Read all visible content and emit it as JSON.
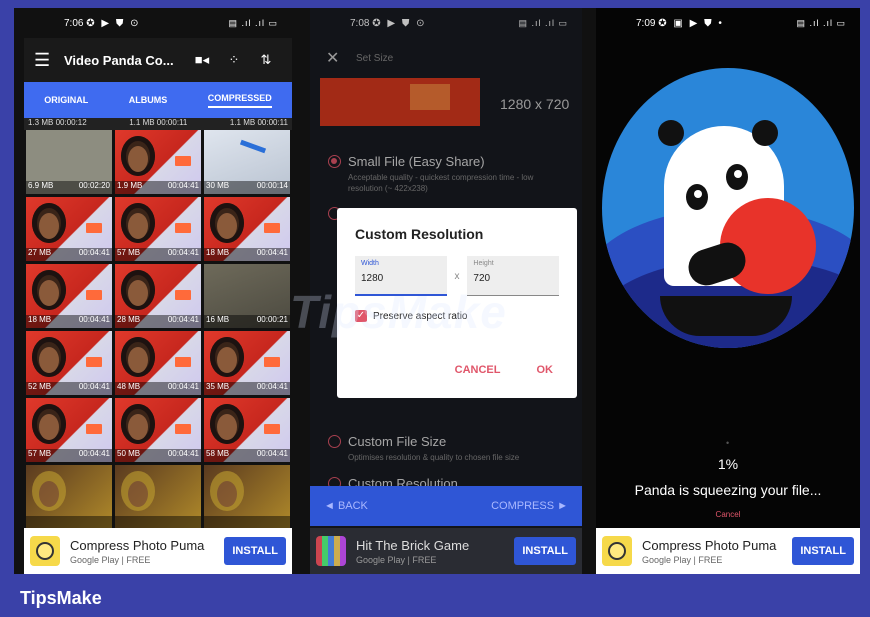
{
  "screen1": {
    "status_time": "7:06",
    "title": "Video Panda Co...",
    "tabs": [
      "ORIGINAL",
      "ALBUMS",
      "COMPRESSED"
    ],
    "active_tab": "COMPRESSED",
    "top_sizes": [
      "1.3 MB  00:00:12",
      "1.1 MB  00:00:11",
      "1.1 MB  00:00:11"
    ],
    "thumbs": [
      {
        "size": "6.9 MB",
        "dur": "00:02:20",
        "kind": "plain"
      },
      {
        "size": "1.9 MB",
        "dur": "00:04:41",
        "kind": "face"
      },
      {
        "size": "30 MB",
        "dur": "00:00:14",
        "kind": "paper"
      },
      {
        "size": "27 MB",
        "dur": "00:04:41",
        "kind": "face"
      },
      {
        "size": "57 MB",
        "dur": "00:04:41",
        "kind": "face"
      },
      {
        "size": "18 MB",
        "dur": "00:04:41",
        "kind": "face"
      },
      {
        "size": "18 MB",
        "dur": "00:04:41",
        "kind": "face"
      },
      {
        "size": "28 MB",
        "dur": "00:04:41",
        "kind": "face"
      },
      {
        "size": "16 MB",
        "dur": "00:00:21",
        "kind": "street"
      },
      {
        "size": "52 MB",
        "dur": "00:04:41",
        "kind": "face"
      },
      {
        "size": "48 MB",
        "dur": "00:04:41",
        "kind": "face"
      },
      {
        "size": "35 MB",
        "dur": "00:04:41",
        "kind": "face"
      },
      {
        "size": "57 MB",
        "dur": "00:04:41",
        "kind": "face"
      },
      {
        "size": "50 MB",
        "dur": "00:04:41",
        "kind": "face"
      },
      {
        "size": "58 MB",
        "dur": "00:04:41",
        "kind": "face"
      },
      {
        "size": "",
        "dur": "",
        "kind": "blurred"
      },
      {
        "size": "",
        "dur": "",
        "kind": "blurred"
      },
      {
        "size": "",
        "dur": "",
        "kind": "blurred"
      }
    ],
    "ad": {
      "name": "Compress Photo Puma",
      "store": "Google Play  |  FREE",
      "button": "INSTALL"
    }
  },
  "screen2": {
    "status_time": "7:08",
    "title": "Set Size",
    "resolution": "1280 x 720",
    "options": [
      {
        "label": "Small File (Easy Share)",
        "desc": "Acceptable quality - quickest compression time - low resolution (~ 422x238)",
        "selected": true
      },
      {
        "label": "Custom File Size",
        "desc": "Optimises resolution & quality to chosen file size",
        "selected": false
      },
      {
        "label": "Custom Resolution",
        "desc": "",
        "selected": false
      }
    ],
    "dialog": {
      "title": "Custom Resolution",
      "width_label": "Width",
      "width_value": "1280",
      "sep": "x",
      "height_label": "Height",
      "height_value": "720",
      "checkbox_label": "Preserve aspect ratio",
      "cancel": "CANCEL",
      "ok": "OK"
    },
    "back": "◄  BACK",
    "compress": "COMPRESS  ►",
    "ad": {
      "name": "Hit The Brick Game",
      "store": "Google Play  |  FREE",
      "button": "INSTALL"
    }
  },
  "screen3": {
    "status_time": "7:09",
    "percent": "1%",
    "message": "Panda is squeezing your file...",
    "cancel": "Cancel",
    "ad": {
      "name": "Compress Photo Puma",
      "store": "Google Play  |  FREE",
      "button": "INSTALL"
    }
  },
  "watermark": "TipsMake",
  "footer": "TipsMake",
  "colors": {
    "accent": "#3f6bf0",
    "install": "#2f56d6",
    "radio": "#e0566a",
    "ball": "#e8332a",
    "background": "#3a41a8"
  }
}
